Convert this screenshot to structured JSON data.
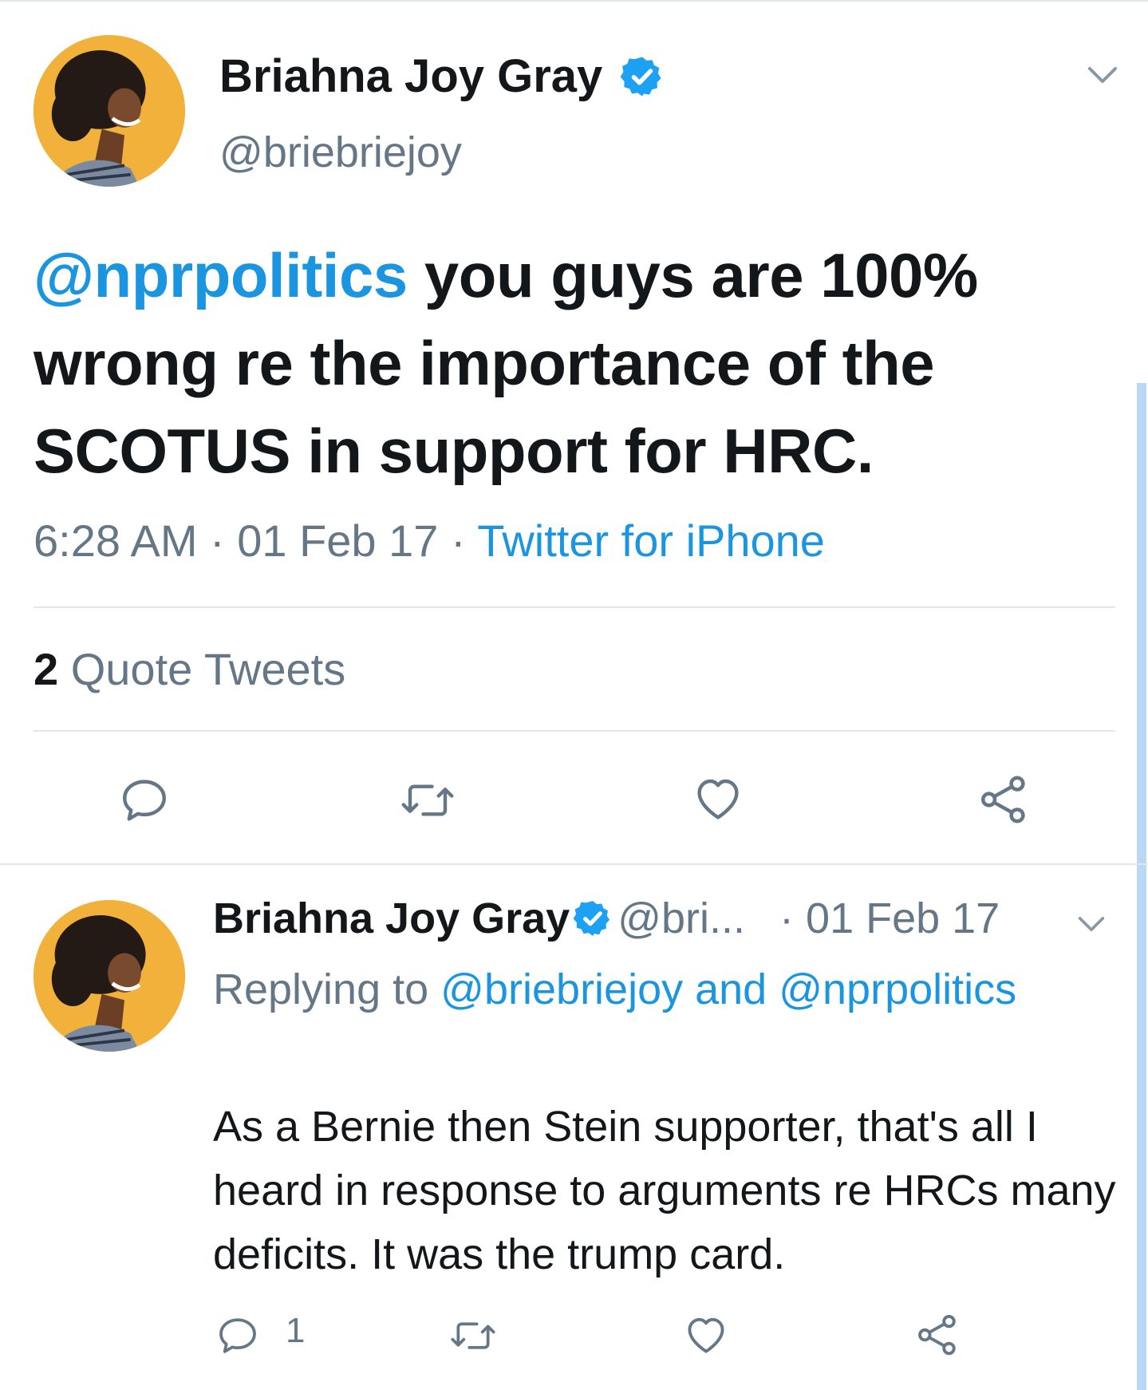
{
  "tweet": {
    "author_name": "Briahna Joy Gray",
    "handle": "@briebriejoy",
    "mention": "@nprpolitics",
    "body": " you guys are 100% wrong re the importance of the SCOTUS in support for HRC.",
    "time": "6:28 AM",
    "sep": " · ",
    "date": "01 Feb 17",
    "source": "Twitter for iPhone",
    "quote_count": "2",
    "quote_label": " Quote Tweets",
    "icons": [
      "reply-icon",
      "retweet-icon",
      "like-icon",
      "share-icon",
      "chevron-down-icon",
      "verified-badge-icon"
    ]
  },
  "reply": {
    "author_name": "Briahna Joy Gray",
    "handle": "@bri...",
    "date_sep": " · ",
    "date": "01 Feb 17",
    "replying_prefix": "Replying to ",
    "replying_to": "@briebriejoy and @nprpolitics",
    "body": "As a Bernie then Stein supporter, that's all I heard in response to arguments re HRCs many deficits. It was the trump card.",
    "reply_count": "1"
  },
  "colors": {
    "link": "#1b95e0",
    "muted": "#657786",
    "text": "#14171a",
    "avatar_bg": "#f2b13b",
    "verified": "#1da1f2"
  }
}
